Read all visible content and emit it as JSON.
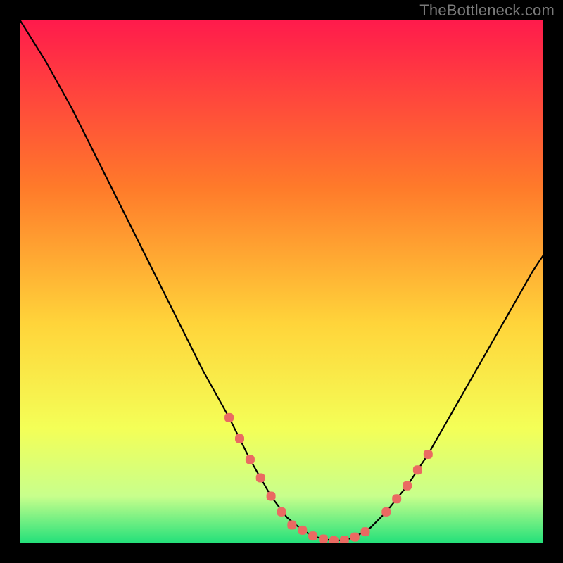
{
  "watermark": "TheBottleneck.com",
  "colors": {
    "background": "#000000",
    "gradient_top": "#ff1a4c",
    "gradient_mid1": "#ff7a2a",
    "gradient_mid2": "#ffd43a",
    "gradient_mid3": "#f4ff57",
    "gradient_low": "#c8ff8c",
    "gradient_bottom": "#22e07a",
    "curve": "#000000",
    "markers": "#ea6a62"
  },
  "chart_data": {
    "type": "line",
    "title": "",
    "xlabel": "",
    "ylabel": "",
    "xlim": [
      0,
      100
    ],
    "ylim": [
      0,
      100
    ],
    "series": [
      {
        "name": "bottleneck-curve",
        "x": [
          0,
          5,
          10,
          15,
          20,
          25,
          30,
          35,
          40,
          44,
          48,
          51,
          54,
          56,
          58,
          60,
          62,
          64,
          67,
          70,
          74,
          78,
          82,
          86,
          90,
          94,
          98,
          100
        ],
        "y": [
          100,
          92,
          83,
          73,
          63,
          53,
          43,
          33,
          24,
          16,
          9,
          5,
          2.5,
          1.4,
          0.8,
          0.5,
          0.6,
          1.2,
          3,
          6,
          11,
          17,
          24,
          31,
          38,
          45,
          52,
          55
        ]
      }
    ],
    "markers": [
      {
        "name": "highlight-left",
        "x": [
          40,
          42,
          44,
          46,
          48,
          50,
          52
        ],
        "y": [
          24,
          20,
          16,
          12.5,
          9,
          6,
          3.5
        ]
      },
      {
        "name": "highlight-bottom",
        "x": [
          52,
          54,
          56,
          58,
          60,
          62,
          64,
          66
        ],
        "y": [
          3.5,
          2.5,
          1.4,
          0.8,
          0.5,
          0.6,
          1.2,
          2.2
        ]
      },
      {
        "name": "highlight-right",
        "x": [
          70,
          72,
          74,
          76,
          78
        ],
        "y": [
          6,
          8.5,
          11,
          14,
          17
        ]
      }
    ]
  }
}
